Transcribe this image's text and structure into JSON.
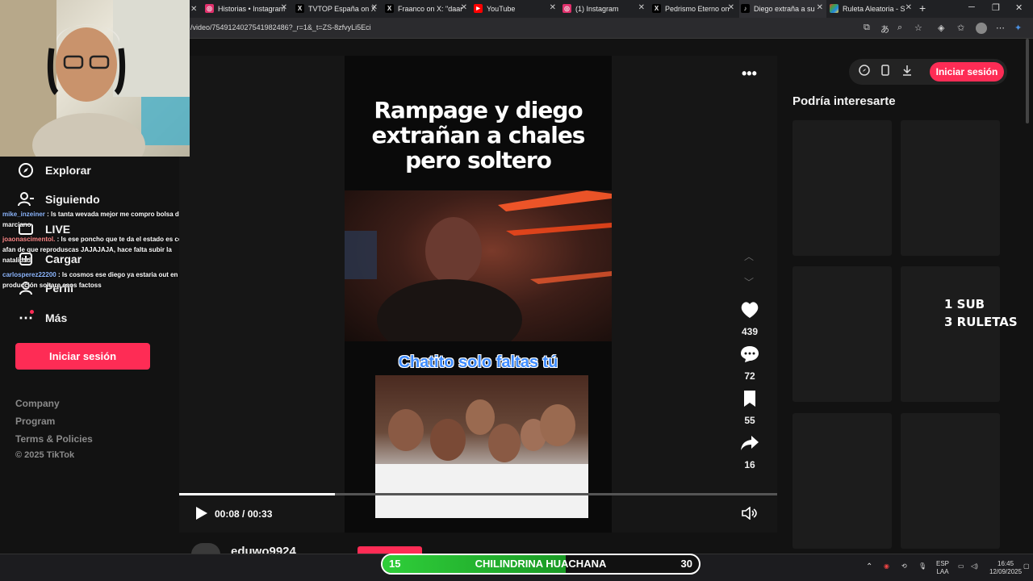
{
  "tabs": [
    {
      "label": "Historias • Instagram",
      "icon": "instagram-icon",
      "color": "#e1306c"
    },
    {
      "label": "TVTOP España on X",
      "icon": "x-icon",
      "color": "#000000"
    },
    {
      "label": "Fraanco on X: \"daar",
      "icon": "x-icon",
      "color": "#000000"
    },
    {
      "label": "YouTube",
      "icon": "youtube-icon",
      "color": "#ff0000"
    },
    {
      "label": "(1) Instagram",
      "icon": "instagram-icon",
      "color": "#e1306c"
    },
    {
      "label": "Pedrismo Eterno on",
      "icon": "x-icon",
      "color": "#000000"
    },
    {
      "label": "Diego extraña a su",
      "icon": "tiktok-icon",
      "color": "#000000"
    },
    {
      "label": "Ruleta Aleatoria - S",
      "icon": "ruleta-icon",
      "color": "#4caf50"
    }
  ],
  "address": {
    "url": "/video/7549124027541982486?_r=1&_t=ZS-8zfvyLi5Eci"
  },
  "nav": {
    "items": [
      {
        "label": "Explorar",
        "icon": "compass-icon"
      },
      {
        "label": "Siguiendo",
        "icon": "user-follow-icon"
      },
      {
        "label": "LIVE",
        "icon": "live-icon"
      },
      {
        "label": "Cargar",
        "icon": "upload-icon"
      },
      {
        "label": "Perfil",
        "icon": "profile-icon"
      },
      {
        "label": "Más",
        "icon": "more-icon"
      }
    ],
    "login": "Iniciar sesión",
    "footer": [
      "Company",
      "Program",
      "Terms & Policies"
    ],
    "copyright": "© 2025 TikTok"
  },
  "chat": [
    {
      "user": "mike_inzeiner",
      "text": " : ls tanta wevada mejor me compro bolsa de marciano"
    },
    {
      "user": "joaonascimentol.",
      "text": " : ls ese poncho que te da el estado es con afan de que reproduscas JAJAJAJA, hace falta subir la natalidad"
    },
    {
      "user": "carlosperez22200",
      "text": " : ls cosmos ese diego ya estaria out en otra producción soltare esos factoss"
    }
  ],
  "video": {
    "title": "Rampage y diego extrañan a chales pero soltero",
    "caption": "Chatito solo faltas tú",
    "likes": "439",
    "comments": "72",
    "saves": "55",
    "shares": "16",
    "time": "00:08 / 00:33",
    "progress": 0.26,
    "author": "eduwo9924"
  },
  "right": {
    "title": "Podría interesarte",
    "login": "Iniciar sesión"
  },
  "overlay": {
    "line1": "1 SUB",
    "line2": "3 RULETAS"
  },
  "ruleta": {
    "left": "15",
    "name": "CHILINDRINA HUACHANA",
    "right": "30",
    "fill": 0.58
  },
  "tray": {
    "lang": "ESP",
    "region": "LAA",
    "time": "16:45",
    "date": "12/09/2025"
  },
  "colors": {
    "accent": "#fe2c55",
    "bg": "#121212"
  }
}
